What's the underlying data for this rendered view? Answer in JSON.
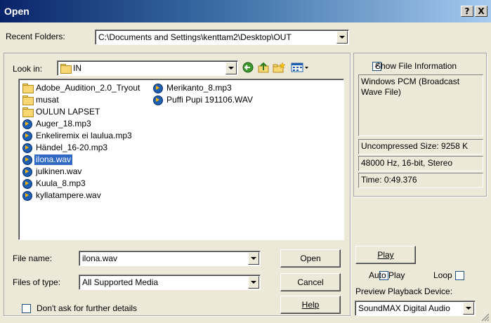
{
  "window": {
    "title": "Open",
    "help_glyph": "?",
    "close_glyph": "X"
  },
  "recent": {
    "label": "Recent Folders:",
    "value": "C:\\Documents and Settings\\kenttam2\\Desktop\\OUT"
  },
  "lookin": {
    "label": "Look in:",
    "value": "IN",
    "icons": [
      "back-icon",
      "up-folder-icon",
      "new-folder-icon",
      "view-menu-icon"
    ]
  },
  "files": {
    "col1": [
      {
        "name": "Adobe_Audition_2.0_Tryout",
        "type": "folder"
      },
      {
        "name": "musat",
        "type": "folder"
      },
      {
        "name": "OULUN LAPSET",
        "type": "folder"
      },
      {
        "name": "Auger_18.mp3",
        "type": "audio"
      },
      {
        "name": "Enkeliremix ei laulua.mp3",
        "type": "audio"
      },
      {
        "name": "Händel_16-20.mp3",
        "type": "audio"
      },
      {
        "name": "ilona.wav",
        "type": "audio",
        "selected": true
      },
      {
        "name": "julkinen.wav",
        "type": "audio"
      },
      {
        "name": "Kuula_8.mp3",
        "type": "audio"
      },
      {
        "name": "kyllatampere.wav",
        "type": "audio"
      }
    ],
    "col2": [
      {
        "name": "Merikanto_8.mp3",
        "type": "audio"
      },
      {
        "name": "Puffi Pupi 191106.WAV",
        "type": "audio"
      }
    ]
  },
  "form": {
    "filename_label": "File name:",
    "filename_value": "ilona.wav",
    "filetype_label": "Files of type:",
    "filetype_value": "All Supported Media",
    "dont_ask_label": "Don't ask for further details"
  },
  "buttons": {
    "open": "Open",
    "cancel": "Cancel",
    "help": "Help",
    "play": "Play"
  },
  "info": {
    "show_file_info_label": "Show File Information",
    "show_file_info_checked": true,
    "format": "Windows PCM (Broadcast Wave File)",
    "size": "Uncompressed Size: 9258 K",
    "specs": "48000 Hz, 16-bit, Stereo",
    "time": "Time:  0:49.376"
  },
  "preview": {
    "auto_play_label": "Auto Play",
    "loop_label": "Loop",
    "device_label": "Preview Playback Device:",
    "device_value": "SoundMAX Digital Audio"
  }
}
